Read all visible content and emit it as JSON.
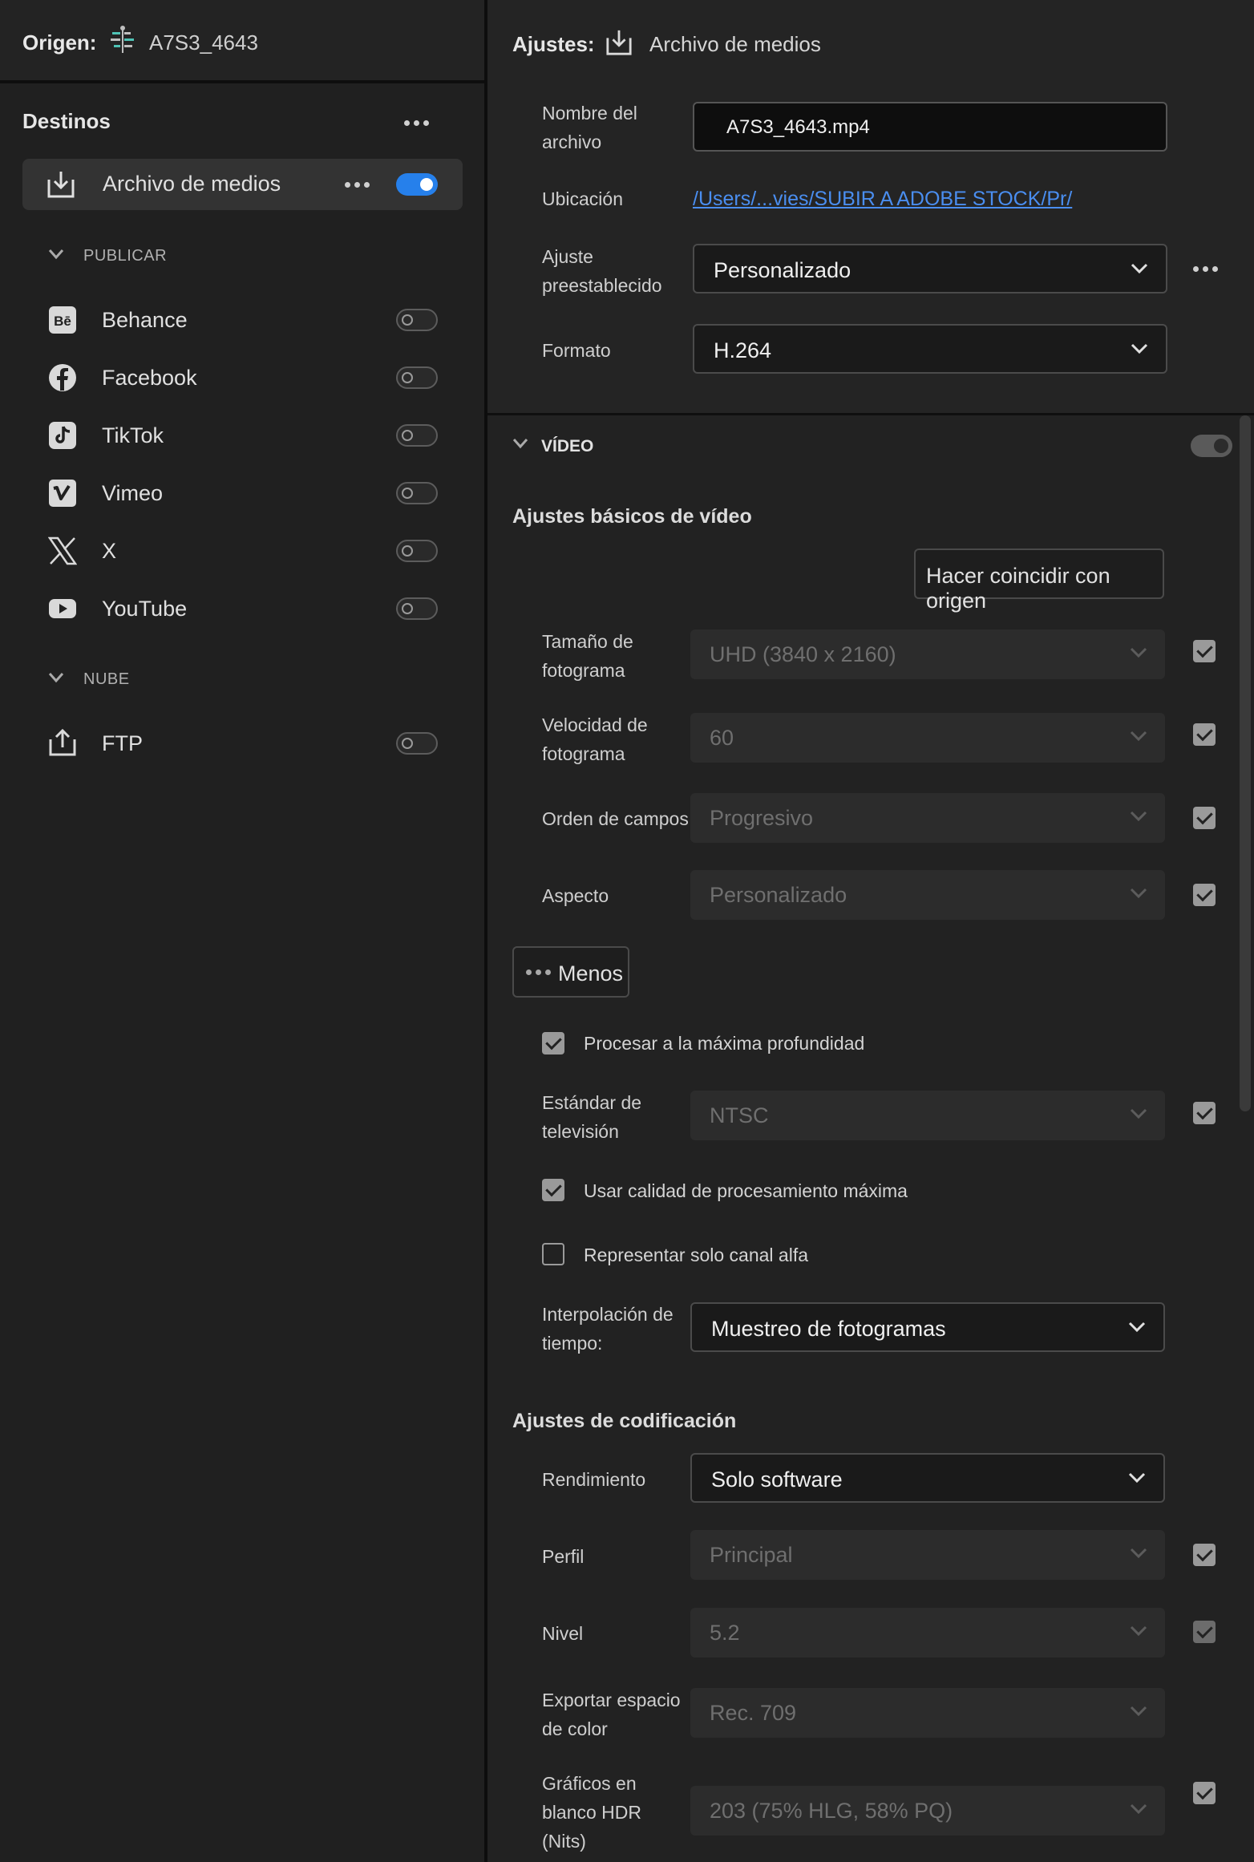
{
  "source": {
    "label": "Origen:",
    "name": "A7S3_4643"
  },
  "destinations": {
    "title": "Destinos",
    "active": {
      "label": "Archivo de medios",
      "enabled": true
    },
    "sections": [
      {
        "title": "PUBLICAR",
        "items": [
          {
            "label": "Behance",
            "icon": "behance-icon"
          },
          {
            "label": "Facebook",
            "icon": "facebook-icon"
          },
          {
            "label": "TikTok",
            "icon": "tiktok-icon"
          },
          {
            "label": "Vimeo",
            "icon": "vimeo-icon"
          },
          {
            "label": "X",
            "icon": "x-icon"
          },
          {
            "label": "YouTube",
            "icon": "youtube-icon"
          }
        ]
      },
      {
        "title": "NUBE",
        "items": [
          {
            "label": "FTP",
            "icon": "upload-icon"
          }
        ]
      }
    ]
  },
  "settings": {
    "label": "Ajustes:",
    "target": "Archivo de medios",
    "filename_label": [
      "Nombre del",
      "archivo"
    ],
    "filename_value": "A7S3_4643.mp4",
    "location_label": "Ubicación",
    "location_value": "/Users/...vies/SUBIR A ADOBE STOCK/Pr/",
    "preset_label": [
      "Ajuste",
      "preestablecido"
    ],
    "preset_value": "Personalizado",
    "format_label": "Formato",
    "format_value": "H.264"
  },
  "video": {
    "section_title": "VÍDEO",
    "basic_title": "Ajustes básicos de vídeo",
    "match_button": "Hacer coincidir con origen",
    "frame_size_label": [
      "Tamaño de",
      "fotograma"
    ],
    "frame_size_value": "UHD (3840 x 2160)",
    "frame_rate_label": [
      "Velocidad de",
      "fotograma"
    ],
    "frame_rate_value": "60",
    "field_order_label": "Orden de campos",
    "field_order_value": "Progresivo",
    "aspect_label": "Aspecto",
    "aspect_value": "Personalizado",
    "less_button": "Menos",
    "max_depth_label": "Procesar a la máxima profundidad",
    "tv_standard_label": [
      "Estándar de",
      "televisión"
    ],
    "tv_standard_value": "NTSC",
    "max_quality_label": "Usar calidad de procesamiento máxima",
    "alpha_only_label": "Representar solo canal alfa",
    "time_interp_label": [
      "Interpolación de",
      "tiempo:"
    ],
    "time_interp_value": "Muestreo de fotogramas"
  },
  "encoding": {
    "title": "Ajustes de codificación",
    "performance_label": "Rendimiento",
    "performance_value": "Solo software",
    "profile_label": "Perfil",
    "profile_value": "Principal",
    "level_label": "Nivel",
    "level_value": "5.2",
    "color_space_label": [
      "Exportar espacio",
      "de color"
    ],
    "color_space_value": "Rec. 709",
    "hdr_label": [
      "Gráficos en",
      "blanco HDR",
      "(Nits)"
    ],
    "hdr_value": "203 (75% HLG, 58% PQ)"
  },
  "colors": {
    "accent": "#2680eb",
    "link": "#4a8ef0"
  }
}
